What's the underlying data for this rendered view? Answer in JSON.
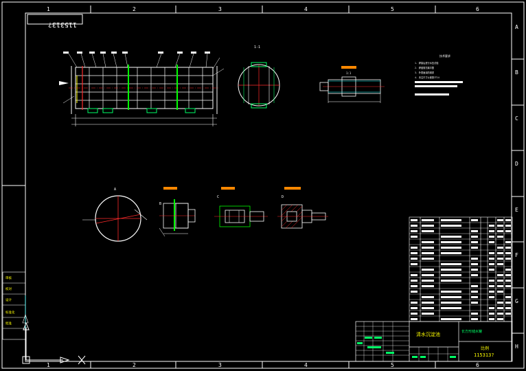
{
  "drawing": {
    "number_stamp": "115313?",
    "grid_cols": [
      "1",
      "2",
      "3",
      "4",
      "5",
      "6"
    ],
    "grid_rows": [
      "A",
      "B",
      "C",
      "D",
      "E",
      "F",
      "G",
      "H"
    ],
    "title_cn": "清水沉淀池",
    "subtitle_cn": "长方形储水罐",
    "drawing_no": "115313?",
    "scale_label": "比例",
    "colors": {
      "frame": "#ffffff",
      "text": "#00ff66",
      "red": "#ff2a2a",
      "cyan": "#00ffff",
      "yellow": "#ffff00",
      "magenta": "#ff33ff",
      "green": "#00ff00"
    }
  },
  "views": {
    "section_label": "1-1",
    "detail_labels": [
      "A",
      "B",
      "C",
      "D"
    ],
    "scale_1_1": "1:1",
    "tech_req_title": "技术要求",
    "tech_req_lines": [
      "1. 焊接后进行水压试验",
      "2. 焊缝需打磨平整",
      "3. 外表面涂防锈漆",
      "4. 未注尺寸公差按IT14"
    ]
  },
  "left_table": [
    "审核",
    "校对",
    "设计",
    "标准化",
    "批准"
  ]
}
